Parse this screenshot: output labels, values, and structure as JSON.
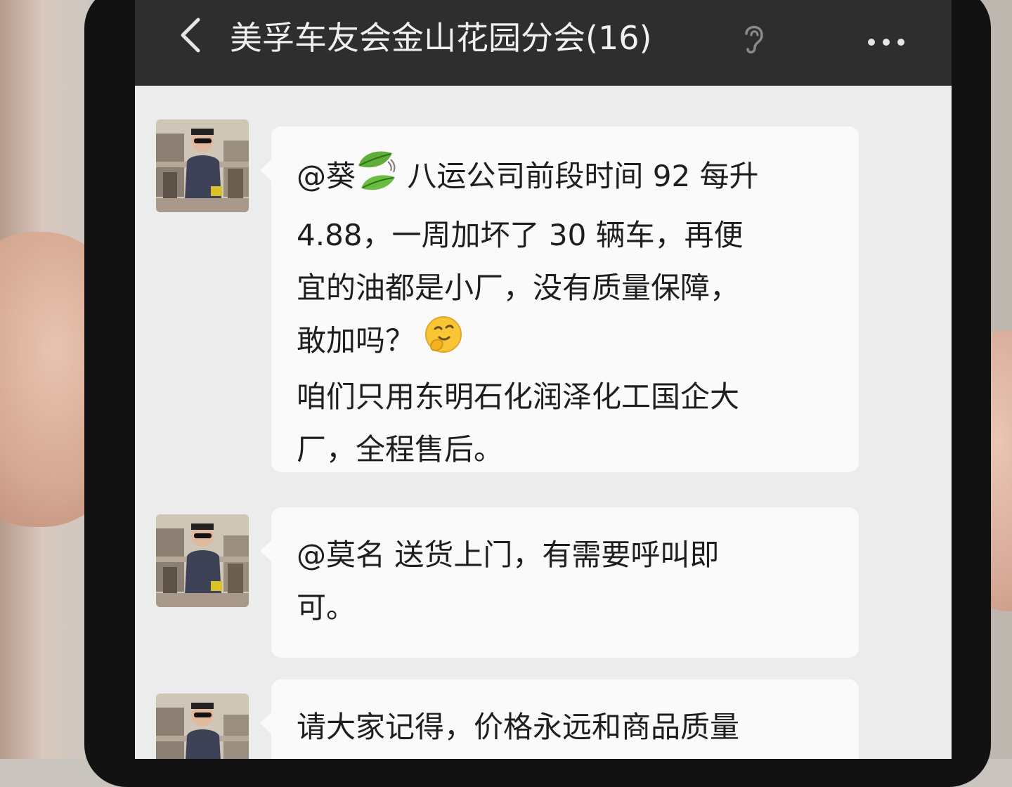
{
  "navbar": {
    "back_icon": "chevron-left-icon",
    "title": "美孚车友会金山花园分会(16)",
    "ear_icon": "ear-icon",
    "more_icon": "more-dots-icon"
  },
  "messages": [
    {
      "avatar": "user-avatar",
      "lines": [
        {
          "before": "@葵",
          "emoji": "leaves-emoji",
          "after": " 八运公司前段时间 92 每升"
        },
        {
          "text": "4.88，一周加坏了 30 辆车，再便"
        },
        {
          "text": "宜的油都是小厂，没有质量保障，"
        },
        {
          "before": "敢加吗？ ",
          "emoji": "thinking-face-emoji"
        },
        {
          "text": "咱们只用东明石化润泽化工国企大"
        },
        {
          "text": "厂，全程售后。"
        }
      ]
    },
    {
      "avatar": "user-avatar",
      "lines": [
        {
          "text": "@莫名  送货上门，有需要呼叫即"
        },
        {
          "text": "可。"
        }
      ]
    },
    {
      "avatar": "user-avatar",
      "lines": [
        {
          "text": "请大家记得，价格永远和商品质量"
        }
      ]
    }
  ],
  "colors": {
    "navbar_bg": "#2e2e2e",
    "chat_bg": "#ececec",
    "bubble_bg": "#fafafa"
  }
}
